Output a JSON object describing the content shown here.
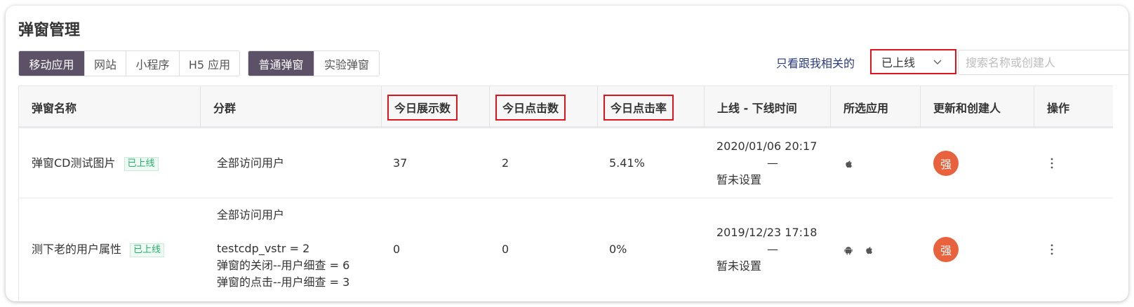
{
  "page": {
    "title": "弹窗管理"
  },
  "platform_tabs": [
    "移动应用",
    "网站",
    "小程序",
    "H5 应用"
  ],
  "type_tabs": [
    "普通弹窗",
    "实验弹窗"
  ],
  "filters": {
    "related_link": "只看跟我相关的",
    "status_value": "已上线",
    "search_placeholder": "搜索名称或创建人"
  },
  "table": {
    "headers": [
      "弹窗名称",
      "分群",
      "今日展示数",
      "今日点击数",
      "今日点击率",
      "上线 - 下线时间",
      "所选应用",
      "更新和创建人",
      "操作"
    ],
    "rows": [
      {
        "name": "弹窗CD测试图片",
        "status": "已上线",
        "segments": [
          "全部访问用户"
        ],
        "impressions": "37",
        "clicks": "2",
        "ctr": "5.41%",
        "start": "2020/01/06 20:17",
        "dash": "—",
        "end": "暂未设置",
        "apps": [
          "apple-icon"
        ],
        "avatar": "强"
      },
      {
        "name": "测下老的用户属性",
        "status": "已上线",
        "segments": [
          "全部访问用户",
          "",
          "testcdp_vstr = 2",
          "弹窗的关闭--用户细查 = 6",
          "弹窗的点击--用户细查 = 3"
        ],
        "impressions": "0",
        "clicks": "0",
        "ctr": "0%",
        "start": "2019/12/23 17:18",
        "dash": "—",
        "end": "暂未设置",
        "apps": [
          "android-icon",
          "apple-icon"
        ],
        "avatar": "强"
      }
    ]
  },
  "colors": {
    "accent": "#5c5166",
    "highlight_box": "#e1141e",
    "status_green": "#24b06a",
    "avatar": "#e8623d",
    "link": "#2a3b80"
  }
}
